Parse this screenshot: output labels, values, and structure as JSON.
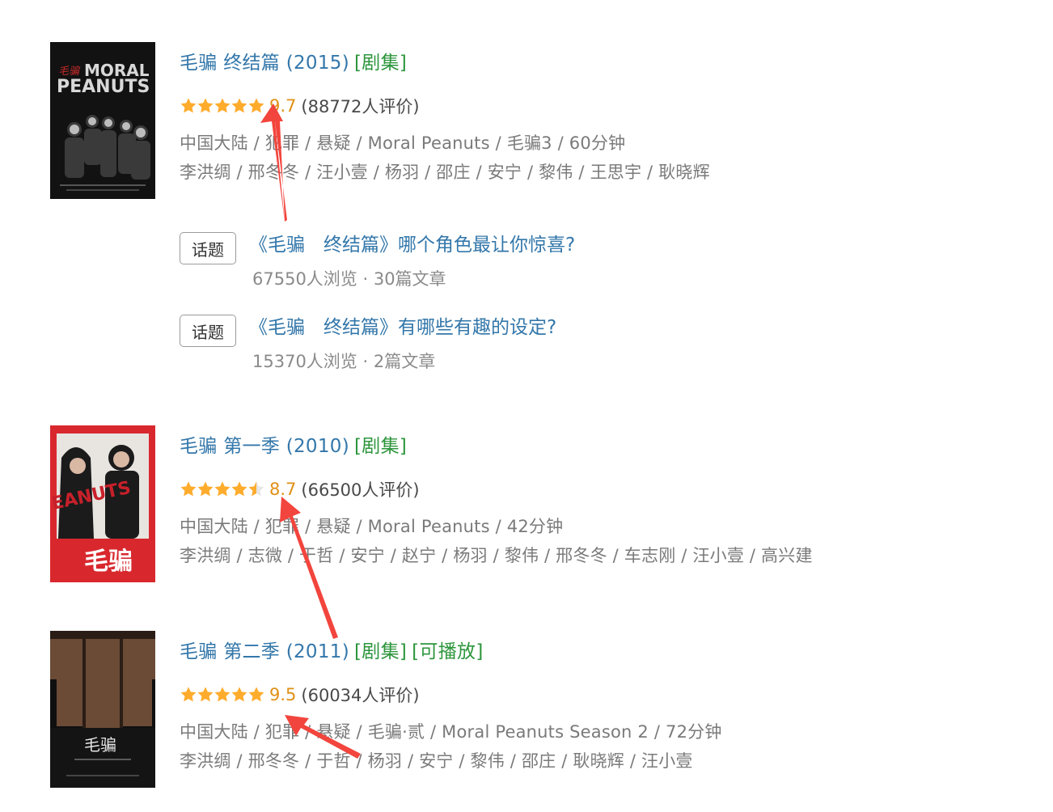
{
  "entries": [
    {
      "title": "毛骗 终结篇 (2015)",
      "tags": [
        "[剧集]"
      ],
      "stars": 5,
      "score": "9.7",
      "votes": "(88772人评价)",
      "meta": "中国大陆 / 犯罪 / 悬疑 / Moral Peanuts / 毛骗3 / 60分钟",
      "cast": "李洪绸 / 邢冬冬 / 汪小壹 / 杨羽 / 邵庄 / 安宁 / 黎伟 / 王思宇 / 耿晓辉",
      "poster_text": [
        "MORAL",
        "PEANUTS"
      ]
    },
    {
      "title": "毛骗 第一季 (2010)",
      "tags": [
        "[剧集]"
      ],
      "stars": 4.5,
      "score": "8.7",
      "votes": "(66500人评价)",
      "meta": "中国大陆 / 犯罪 / 悬疑 / Moral Peanuts / 42分钟",
      "cast": "李洪绸 / 志微 / 于哲 / 安宁 / 赵宁 / 杨羽 / 黎伟 / 邢冬冬 / 车志刚 / 汪小壹 / 高兴建",
      "poster_text": [
        "EANUTS",
        "毛骗"
      ]
    },
    {
      "title": "毛骗 第二季 (2011)",
      "tags": [
        "[剧集]",
        "[可播放]"
      ],
      "stars": 5,
      "score": "9.5",
      "votes": "(60034人评价)",
      "meta": "中国大陆 / 犯罪 / 悬疑 / 毛骗·贰 / Moral Peanuts Season 2 / 72分钟",
      "cast": "李洪绸 / 邢冬冬 / 于哲 / 杨羽 / 安宁 / 黎伟 / 邵庄 / 耿晓辉 / 汪小壹",
      "poster_text": [
        "毛骗"
      ]
    }
  ],
  "topics": [
    {
      "badge": "话题",
      "title": "《毛骗　终结篇》哪个角色最让你惊喜?",
      "meta": "67550人浏览 · 30篇文章"
    },
    {
      "badge": "话题",
      "title": "《毛骗　终结篇》有哪些有趣的设定?",
      "meta": "15370人浏览 · 2篇文章"
    }
  ],
  "colors": {
    "link": "#3377aa",
    "tag": "#2e963d",
    "score": "#e09015",
    "star": "#ffac2d",
    "arrow": "#f2453d"
  }
}
